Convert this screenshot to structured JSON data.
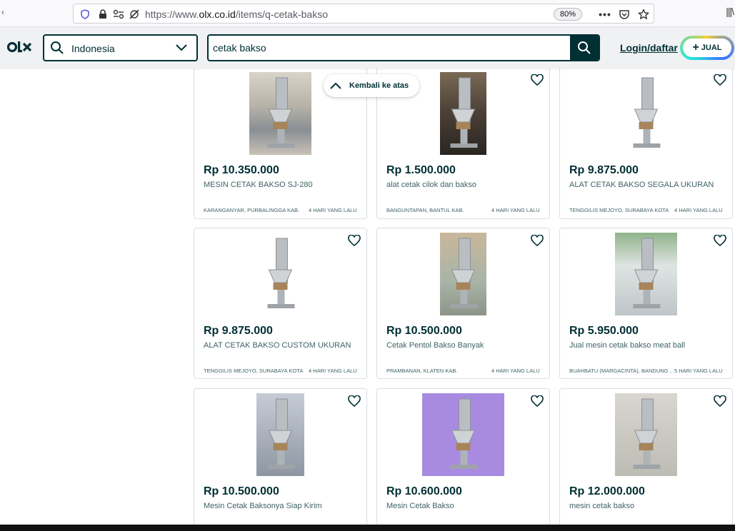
{
  "browser": {
    "url_prefix": "https://www.",
    "url_domain": "olx.co.id",
    "url_path": "/items/q-cetak-bakso",
    "zoom": "80%"
  },
  "header": {
    "location": "Indonesia",
    "search_value": "cetak bakso",
    "login_label": "Login/daftar",
    "sell_label": "JUAL"
  },
  "back_to_top": "Kembali ke atas",
  "listings": [
    {
      "price": "Rp 10.350.000",
      "title": "MESIN CETAK BAKSO SJ-280",
      "location": "KARANGANYAR, PURBALINGGA KAB.",
      "date": "4 HARI YANG LALU"
    },
    {
      "price": "Rp 1.500.000",
      "title": "alat cetak cilok dan bakso",
      "location": "BANGUNTAPAN, BANTUL KAB.",
      "date": "4 HARI YANG LALU"
    },
    {
      "price": "Rp 9.875.000",
      "title": "ALAT CETAK BAKSO SEGALA UKURAN",
      "location": "TENGGILIS MEJOYO, SURABAYA KOTA",
      "date": "4 HARI YANG LALU"
    },
    {
      "price": "Rp 9.875.000",
      "title": "ALAT CETAK BAKSO CUSTOM UKURAN",
      "location": "TENGGILIS MEJOYO, SURABAYA KOTA",
      "date": "4 HARI YANG LALU"
    },
    {
      "price": "Rp 10.500.000",
      "title": "Cetak Pentol Bakso Banyak",
      "location": "PRAMBANAN, KLATEN KAB.",
      "date": "4 HARI YANG LALU"
    },
    {
      "price": "Rp 5.950.000",
      "title": "Jual mesin cetak bakso meat ball",
      "location": "BUAHBATU (MARGACINTA), BANDUNG ...",
      "date": "5 HARI YANG LALU"
    },
    {
      "price": "Rp 10.500.000",
      "title": "Mesin Cetak Baksonya Siap Kirim",
      "location": "",
      "date": ""
    },
    {
      "price": "Rp 10.600.000",
      "title": "Mesin Cetak Bakso",
      "location": "",
      "date": ""
    },
    {
      "price": "Rp 12.000.000",
      "title": "mesin cetak bakso",
      "location": "",
      "date": ""
    }
  ],
  "colors": {
    "brand": "#002f34",
    "header_bg": "#eff1f3",
    "secondary_text": "#406367"
  }
}
